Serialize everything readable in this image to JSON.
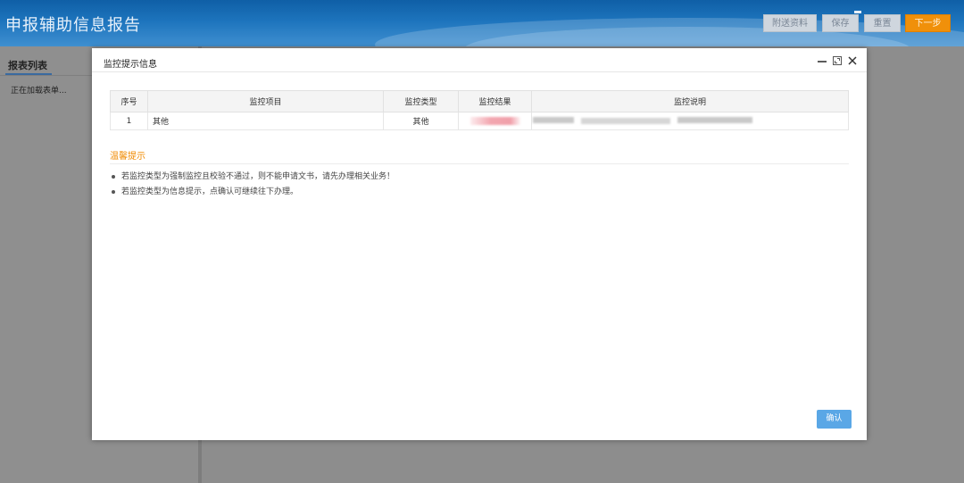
{
  "header": {
    "title": "申报辅助信息报告",
    "buttons": {
      "attach": "附送资料",
      "save": "保存",
      "reset": "重置",
      "next": "下一步"
    }
  },
  "sidebar": {
    "tab": "报表列表",
    "loading": "正在加载表单..."
  },
  "dialog": {
    "title": "监控提示信息",
    "table": {
      "headers": [
        "序号",
        "监控项目",
        "监控类型",
        "监控结果",
        "监控说明"
      ],
      "rows": [
        {
          "index": "1",
          "item": "其他",
          "type": "其他",
          "result": "",
          "description": ""
        }
      ]
    },
    "tips_title": "温馨提示",
    "tips": [
      "若监控类型为强制监控且校验不通过，则不能申请文书，请先办理相关业务！",
      "若监控类型为信息提示，点确认可继续往下办理。"
    ],
    "confirm_label": "确认"
  }
}
